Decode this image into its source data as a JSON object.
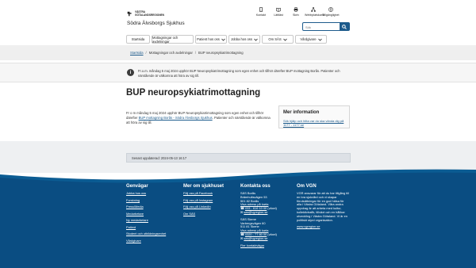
{
  "header": {
    "logo_text": "VÄSTRA GÖTALANDSREGIONEN",
    "site_name": "Södra Älvsborgs Sjukhus",
    "tools": [
      {
        "label": "Kontakt",
        "icon": "phone-icon"
      },
      {
        "label": "Lättläst",
        "icon": "book-icon"
      },
      {
        "label": "Skriv",
        "icon": "print-icon"
      },
      {
        "label": "Webbplatskarta",
        "icon": "sitemap-icon"
      },
      {
        "label": "Tillgänglighet",
        "icon": "accessibility-icon"
      }
    ],
    "search_placeholder": "Sök"
  },
  "nav": [
    {
      "label": "Startsida",
      "has_chevron": false
    },
    {
      "label": "Mottagningar och avdelningar",
      "has_chevron": false
    },
    {
      "label": "Patient hos oss",
      "has_chevron": true
    },
    {
      "label": "Jobba hos oss",
      "has_chevron": true
    },
    {
      "label": "Om SÄS",
      "has_chevron": true
    },
    {
      "label": "Vårdgivare",
      "has_chevron": true
    }
  ],
  "breadcrumb": {
    "items": [
      "Startsida",
      "Mottagningar och avdelningar",
      "BUP neuropsykiatrimottagning"
    ]
  },
  "notice": {
    "text": "Fr.o.m. måndag 5 maj 2024 upphör BUP Neuropsykiatrimottagning som egen enhet och tillhör därefter BUP mottagning Borås. Patienter och närstående är välkomna att höra av sig till."
  },
  "main": {
    "title": "BUP neuropsykiatrimottagning",
    "lead_before": "Fr o m måndag 5 maj 2024 upphör BUP Neuropsykiatrimottagning som egen enhet och tillhör därefter ",
    "lead_link": "BUP mottagning Borås - Södra Älvsborgs Sjukhus",
    "lead_after": ". Patienter och närstående är välkomna att höra av sig till.",
    "info_title": "Mer information",
    "info_link": "Sök hjälp och hitta var du ska vända dig på 1177 - 1177.se"
  },
  "updated": "Senast uppdaterad: 2024-05-13 16:17",
  "footer": {
    "genvagar": {
      "title": "Genvägar",
      "links": [
        "Jobba hos oss",
        "Forskning",
        "Press/Media",
        "Medarbetare",
        "Ny medarbetare",
        "Patient",
        "Student och utbildningsenhet",
        "Vårdgivare"
      ]
    },
    "mer_om": {
      "title": "Mer om sjukhuset",
      "links": [
        "Följ oss på Facebook",
        "Följ oss på Instagram",
        "Följ oss på LinkedIn",
        "Om SÄS"
      ]
    },
    "kontakta": {
      "title": "Kontakta oss",
      "boras": [
        "SÄS Borås",
        "Brämhultsvägen 53",
        "501 82 Borås"
      ],
      "boras_map": "Visa adress på karta",
      "boras_phone": "033 - 616 10 00",
      "boras_phone_suffix": " (växel)",
      "boras_email": "sas@vgregion.se",
      "skene": [
        "SÄS Skene",
        "Varbergsvägen 60",
        "511 81 Skene"
      ],
      "skene_map": "Visa adress på karta",
      "skene_phone": "0320 - 77 80 00",
      "skene_phone_suffix": " (växel)",
      "skene_email": "sas@vgregion.se",
      "more_link": "Fler kontaktvägar"
    },
    "om_vgn": {
      "title": "Om VGN",
      "text": "VGR ansvarar för att du har tillgång till en bra sjukvård och vi skapar förutsättningar för en god hälsa för alla i Västra Götaland. Våra andra uppdrag är att arbeta med kultur, kollektivtrafik, tillväxt och en hållbar utveckling i Västra Götaland. Vi är en politiskt styrd organisation.",
      "link": "www.vgregion.se"
    }
  }
}
